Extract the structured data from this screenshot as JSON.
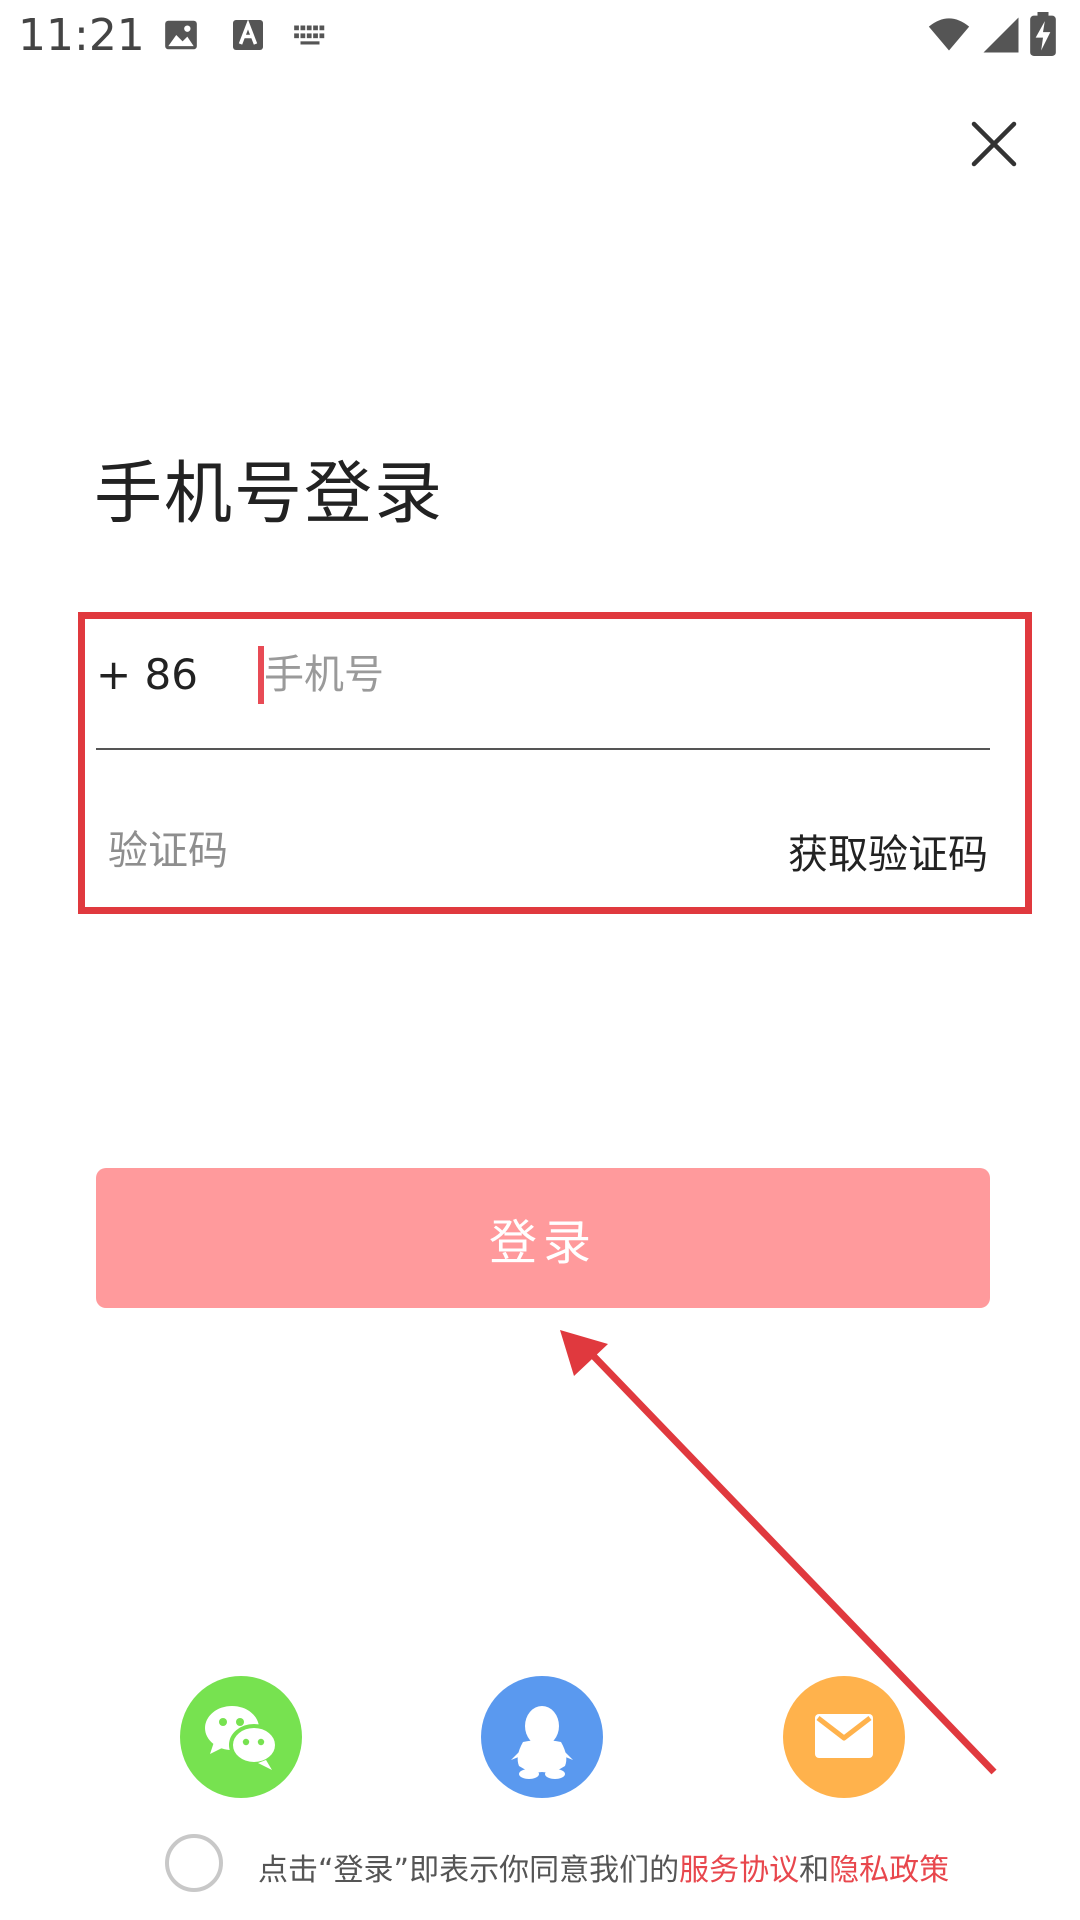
{
  "status_bar": {
    "time": "11:21",
    "icons": [
      "image-icon",
      "text-a-icon",
      "keyboard-icon",
      "wifi-icon",
      "signal-icon",
      "battery-charging-icon"
    ]
  },
  "header": {
    "close_icon": "close-icon",
    "title": "手机号登录"
  },
  "form": {
    "country_code": "+ 86",
    "phone_placeholder": "手机号",
    "code_placeholder": "验证码",
    "get_code_label": "获取验证码"
  },
  "login_button": {
    "label": "登录",
    "color": "#ff9a9c"
  },
  "social_logins": [
    {
      "name": "wechat",
      "icon": "wechat-icon",
      "color": "#77e250"
    },
    {
      "name": "qq",
      "icon": "qq-penguin-icon",
      "color": "#5a99ef"
    },
    {
      "name": "email",
      "icon": "mail-icon",
      "color": "#ffb24c"
    }
  ],
  "agreement": {
    "prefix": "点击“登录”即表示你同意我们的",
    "service_terms": "服务协议",
    "conjunction": "和",
    "privacy_policy": "隐私政策",
    "link_color": "#e8474d"
  },
  "annotations": {
    "highlight_color": "#e0393e"
  }
}
